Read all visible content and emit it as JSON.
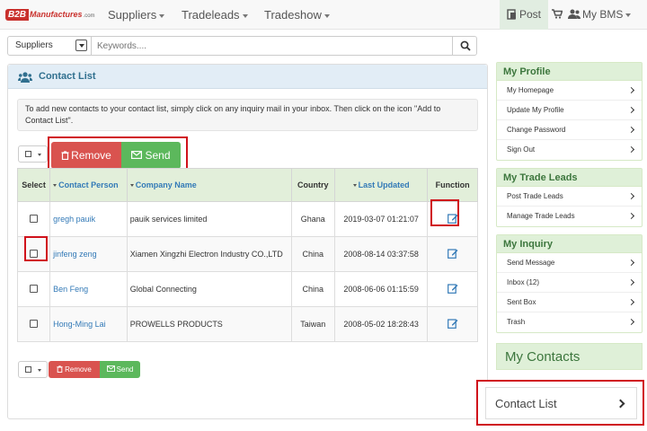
{
  "logo": {
    "b2b": "B2B",
    "name": "Manufactures",
    "domain": ".com"
  },
  "nav": {
    "suppliers": "Suppliers",
    "tradeleads": "Tradeleads",
    "tradeshow": "Tradeshow",
    "post": "Post",
    "my_bms": "My BMS"
  },
  "search": {
    "category": "Suppliers",
    "placeholder": "Keywords...."
  },
  "contact_list": {
    "title": "Contact List",
    "info": "To add new contacts to your contact list, simply click on any inquiry mail in your inbox. Then click on the icon \"Add to Contact List\".",
    "remove_label": "Remove",
    "send_label": "Send",
    "columns": {
      "select": "Select",
      "contact_person": "Contact Person",
      "company_name": "Company Name",
      "country": "Country",
      "last_updated": "Last Updated",
      "function": "Function"
    },
    "rows": [
      {
        "person": "gregh pauik",
        "company": "pauik services limited",
        "country": "Ghana",
        "updated": "2019-03-07 01:21:07"
      },
      {
        "person": "jinfeng zeng",
        "company": "Xiamen Xingzhi Electron Industry CO.,LTD",
        "country": "China",
        "updated": "2008-08-14 03:37:58"
      },
      {
        "person": "Ben Feng",
        "company": "Global Connecting",
        "country": "China",
        "updated": "2008-06-06 01:15:59"
      },
      {
        "person": "Hong-Ming Lai",
        "company": "PROWELLS PRODUCTS",
        "country": "Taiwan",
        "updated": "2008-05-02 18:28:43"
      }
    ]
  },
  "sidebar": {
    "my_profile": {
      "title": "My Profile",
      "items": [
        "My Homepage",
        "Update My Profile",
        "Change Password",
        "Sign Out"
      ]
    },
    "my_trade_leads": {
      "title": "My Trade Leads",
      "items": [
        "Post Trade Leads",
        "Manage Trade Leads"
      ]
    },
    "my_inquiry": {
      "title": "My Inquiry",
      "items": [
        "Send Message",
        "Inbox (12)",
        "Sent Box",
        "Trash"
      ]
    },
    "my_contacts": {
      "title": "My Contacts",
      "contact_list": "Contact List"
    }
  },
  "colors": {
    "brand_red": "#c9302c",
    "danger": "#d9534f",
    "success": "#5cb85c",
    "link": "#337ab7",
    "highlight": "#d0111b"
  },
  "icons": [
    "post-icon",
    "cart-icon",
    "users-icon",
    "search-icon",
    "trash-icon",
    "envelope-icon",
    "edit-icon",
    "chevron-right-icon"
  ]
}
